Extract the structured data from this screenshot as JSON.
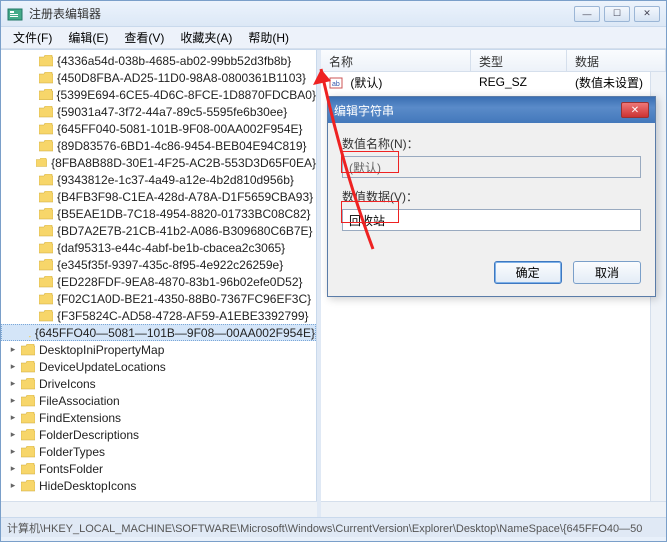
{
  "window": {
    "title": "注册表编辑器"
  },
  "menu": {
    "file": "文件(F)",
    "edit": "编辑(E)",
    "view": "查看(V)",
    "favorites": "收藏夹(A)",
    "help": "帮助(H)"
  },
  "tree": {
    "guids": [
      "{4336a54d-038b-4685-ab02-99bb52d3fb8b}",
      "{450D8FBA-AD25-11D0-98A8-0800361B1103}",
      "{5399E694-6CE5-4D6C-8FCE-1D8870FDCBA0}",
      "{59031a47-3f72-44a7-89c5-5595fe6b30ee}",
      "{645FF040-5081-101B-9F08-00AA002F954E}",
      "{89D83576-6BD1-4c86-9454-BEB04E94C819}",
      "{8FBA8B88D-30E1-4F25-AC2B-553D3D65F0EA}",
      "{9343812e-1c37-4a49-a12e-4b2d810d956b}",
      "{B4FB3F98-C1EA-428d-A78A-D1F5659CBA93}",
      "{B5EAE1DB-7C18-4954-8820-01733BC08C82}",
      "{BD7A2E7B-21CB-41b2-A086-B309680C6B7E}",
      "{daf95313-e44c-4abf-be1b-cbacea2c3065}",
      "{e345f35f-9397-435c-8f95-4e922c26259e}",
      "{ED228FDF-9EA8-4870-83b1-96b02efe0D52}",
      "{F02C1A0D-BE21-4350-88B0-7367FC96EF3C}",
      "{F3F5824C-AD58-4728-AF59-A1EBE3392799}"
    ],
    "selected": "{645FFO40—5081—101B—9F08—00AA002F954E}",
    "siblings": [
      "DesktopIniPropertyMap",
      "DeviceUpdateLocations",
      "DriveIcons",
      "FileAssociation",
      "FindExtensions",
      "FolderDescriptions",
      "FolderTypes",
      "FontsFolder",
      "HideDesktopIcons"
    ]
  },
  "list": {
    "headers": {
      "name": "名称",
      "type": "类型",
      "data": "数据"
    },
    "row": {
      "name": "(默认)",
      "type": "REG_SZ",
      "data": "(数值未设置)"
    }
  },
  "dialog": {
    "title": "编辑字符串",
    "name_label": "数值名称(N)：",
    "name_value": "(默认)",
    "data_label": "数值数据(V)：",
    "data_value": "回收站",
    "ok": "确定",
    "cancel": "取消"
  },
  "statusbar": {
    "path": "计算机\\HKEY_LOCAL_MACHINE\\SOFTWARE\\Microsoft\\Windows\\CurrentVersion\\Explorer\\Desktop\\NameSpace\\{645FFO40—50"
  }
}
